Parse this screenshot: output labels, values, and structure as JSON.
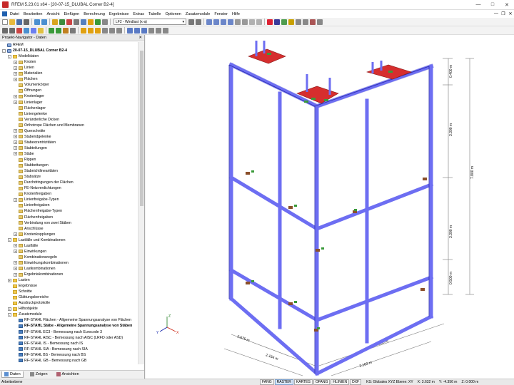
{
  "window": {
    "title": "RFEM 5.23.01 x64 - [20-07-15_DLUBAL Corner B2-4]"
  },
  "menu": [
    "Datei",
    "Bearbeiten",
    "Ansicht",
    "Einfügen",
    "Berechnung",
    "Ergebnisse",
    "Extras",
    "Tabelle",
    "Optionen",
    "Zusatzmodule",
    "Fenster",
    "Hilfe"
  ],
  "toolbar": {
    "loadcase": "LF2 - Windlast (x-a)"
  },
  "navigator": {
    "title": "Projekt-Navigator - Daten",
    "tree": [
      {
        "label": "RFEM",
        "level": 0,
        "exp": "",
        "icon": "root"
      },
      {
        "label": "20-07-15_DLUBAL Corner B2-4",
        "level": 0,
        "exp": "-",
        "icon": "root",
        "bold": true
      },
      {
        "label": "Modelldaten",
        "level": 1,
        "exp": "-",
        "icon": "folder"
      },
      {
        "label": "Knoten",
        "level": 2,
        "exp": "+",
        "icon": "item"
      },
      {
        "label": "Linien",
        "level": 2,
        "exp": "+",
        "icon": "item"
      },
      {
        "label": "Materialien",
        "level": 2,
        "exp": "+",
        "icon": "item"
      },
      {
        "label": "Flächen",
        "level": 2,
        "exp": "+",
        "icon": "item"
      },
      {
        "label": "Volumenkörper",
        "level": 2,
        "exp": "",
        "icon": "item"
      },
      {
        "label": "Öffnungen",
        "level": 2,
        "exp": "",
        "icon": "item"
      },
      {
        "label": "Knotenlager",
        "level": 2,
        "exp": "+",
        "icon": "item"
      },
      {
        "label": "Linienlager",
        "level": 2,
        "exp": "+",
        "icon": "item"
      },
      {
        "label": "Flächenlager",
        "level": 2,
        "exp": "",
        "icon": "item"
      },
      {
        "label": "Liniengelenke",
        "level": 2,
        "exp": "",
        "icon": "item"
      },
      {
        "label": "Veränderliche Dicken",
        "level": 2,
        "exp": "",
        "icon": "item"
      },
      {
        "label": "Orthotrope Flächen und Membranen",
        "level": 2,
        "exp": "",
        "icon": "item"
      },
      {
        "label": "Querschnitte",
        "level": 2,
        "exp": "+",
        "icon": "item"
      },
      {
        "label": "Stabendgelenke",
        "level": 2,
        "exp": "+",
        "icon": "item"
      },
      {
        "label": "Stabexzentrizitäten",
        "level": 2,
        "exp": "+",
        "icon": "item"
      },
      {
        "label": "Stabteilungen",
        "level": 2,
        "exp": "+",
        "icon": "item"
      },
      {
        "label": "Stäbe",
        "level": 2,
        "exp": "+",
        "icon": "item"
      },
      {
        "label": "Rippen",
        "level": 2,
        "exp": "",
        "icon": "item"
      },
      {
        "label": "Stabbettungen",
        "level": 2,
        "exp": "",
        "icon": "item"
      },
      {
        "label": "Stabnichtlinearitäten",
        "level": 2,
        "exp": "",
        "icon": "item"
      },
      {
        "label": "Stabsätze",
        "level": 2,
        "exp": "",
        "icon": "item"
      },
      {
        "label": "Durchdringungen der Flächen",
        "level": 2,
        "exp": "",
        "icon": "item"
      },
      {
        "label": "FE-Netzverdichtungen",
        "level": 2,
        "exp": "",
        "icon": "item"
      },
      {
        "label": "Knotenfreigaben",
        "level": 2,
        "exp": "",
        "icon": "item"
      },
      {
        "label": "Linienfreigabe-Typen",
        "level": 2,
        "exp": "+",
        "icon": "item"
      },
      {
        "label": "Linienfreigaben",
        "level": 2,
        "exp": "",
        "icon": "item"
      },
      {
        "label": "Flächenfreigabe-Typen",
        "level": 2,
        "exp": "",
        "icon": "item"
      },
      {
        "label": "Flächenfreigaben",
        "level": 2,
        "exp": "",
        "icon": "item"
      },
      {
        "label": "Verbindung von zwei Stäben",
        "level": 2,
        "exp": "",
        "icon": "item"
      },
      {
        "label": "Anschlüsse",
        "level": 2,
        "exp": "",
        "icon": "item"
      },
      {
        "label": "Knotenkopplungen",
        "level": 2,
        "exp": "+",
        "icon": "item"
      },
      {
        "label": "Lastfälle und Kombinationen",
        "level": 1,
        "exp": "-",
        "icon": "folder"
      },
      {
        "label": "Lastfälle",
        "level": 2,
        "exp": "+",
        "icon": "item"
      },
      {
        "label": "Einwirkungen",
        "level": 2,
        "exp": "+",
        "icon": "item"
      },
      {
        "label": "Kombinationsregeln",
        "level": 2,
        "exp": "",
        "icon": "item"
      },
      {
        "label": "Einwirkungskombinationen",
        "level": 2,
        "exp": "+",
        "icon": "item"
      },
      {
        "label": "Lastkombinationen",
        "level": 2,
        "exp": "+",
        "icon": "item"
      },
      {
        "label": "Ergebniskombinationen",
        "level": 2,
        "exp": "+",
        "icon": "item"
      },
      {
        "label": "Lasten",
        "level": 1,
        "exp": "+",
        "icon": "folder"
      },
      {
        "label": "Ergebnisse",
        "level": 1,
        "exp": "",
        "icon": "folder"
      },
      {
        "label": "Schnitte",
        "level": 1,
        "exp": "",
        "icon": "folder"
      },
      {
        "label": "Glättungsbereiche",
        "level": 1,
        "exp": "",
        "icon": "folder"
      },
      {
        "label": "Ausdruckprotokolle",
        "level": 1,
        "exp": "",
        "icon": "folder"
      },
      {
        "label": "Hilfsobjekte",
        "level": 1,
        "exp": "+",
        "icon": "folder"
      },
      {
        "label": "Zusatzmodule",
        "level": 1,
        "exp": "-",
        "icon": "folder"
      },
      {
        "label": "RF-STAHL Flächen - Allgemeine Spannungsanalyse von Flächen",
        "level": 2,
        "exp": "",
        "icon": "mod"
      },
      {
        "label": "RF-STAHL Stäbe - Allgemeine Spannungsanalyse von Stäben",
        "level": 2,
        "exp": "",
        "icon": "mod",
        "bold": true
      },
      {
        "label": "RF-STAHL EC3 - Bemessung nach Eurocode 3",
        "level": 2,
        "exp": "",
        "icon": "mod"
      },
      {
        "label": "RF-STAHL AISC - Bemessung nach AISC (LRFD oder ASD)",
        "level": 2,
        "exp": "",
        "icon": "mod"
      },
      {
        "label": "RF-STAHL IS - Bemessung nach IS",
        "level": 2,
        "exp": "",
        "icon": "mod"
      },
      {
        "label": "RF-STAHL SIA - Bemessung nach SIA",
        "level": 2,
        "exp": "",
        "icon": "mod"
      },
      {
        "label": "RF-STAHL BS - Bemessung nach BS",
        "level": 2,
        "exp": "",
        "icon": "mod"
      },
      {
        "label": "RF-STAHL GB - Bemessung nach GB",
        "level": 2,
        "exp": "",
        "icon": "mod"
      }
    ],
    "tabs": [
      "Daten",
      "Zeigen",
      "Ansichten"
    ]
  },
  "viewport": {
    "dimensions": {
      "right_top": "0.400 m",
      "right_mid": "3.300 m",
      "right_total": "7.800 m",
      "right_low": "3.300 m",
      "right_bottom": "0.500 m",
      "bottom_left_a": "2.675 m",
      "bottom_right_a": "3.200 m",
      "bottom_left_b": "2.164 m",
      "bottom_right_b": "2.162 m"
    },
    "axes": {
      "x": "X",
      "y": "Y",
      "z": "Z"
    },
    "colors": {
      "frame": "#6d6ef2",
      "frame_edge": "#3436b8",
      "plate": "#d62e2e",
      "support": "#3a9a3a"
    }
  },
  "status": {
    "left": "Arbeitsebene",
    "buttons": [
      "FANG",
      "RASTER",
      "KARTES",
      "OFANG",
      "HLINIEN",
      "DXF"
    ],
    "active_button": "RASTER",
    "plane": "KS: Globales XYZ  Ebene: XY",
    "x": "X: 3.632 m",
    "y": "Y: -4.356 m",
    "z": "Z: 0.000 m"
  }
}
